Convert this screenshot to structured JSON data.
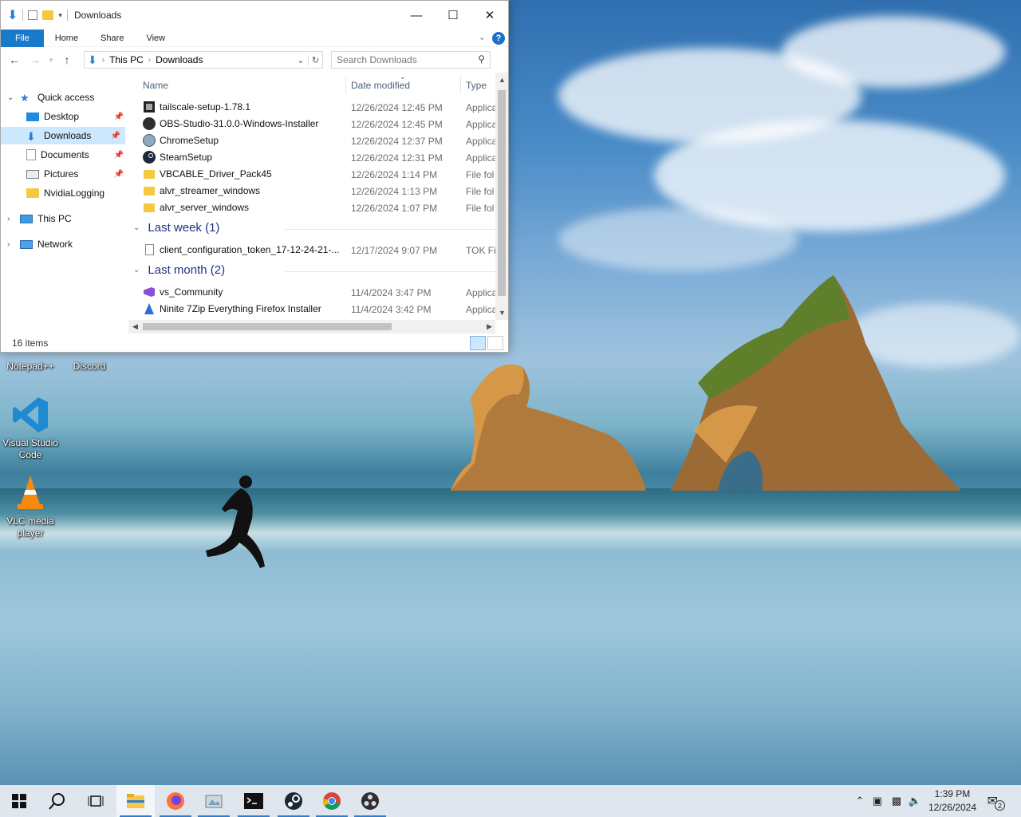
{
  "window": {
    "title": "Downloads",
    "ribbon_tabs": [
      "File",
      "Home",
      "Share",
      "View"
    ],
    "help_label": "?",
    "address": {
      "root": "This PC",
      "current": "Downloads"
    },
    "search_placeholder": "Search Downloads",
    "status_count": "16 items"
  },
  "nav_pane": {
    "quick_access": "Quick access",
    "items": [
      {
        "label": "Desktop",
        "pinned": true
      },
      {
        "label": "Downloads",
        "pinned": true,
        "selected": true
      },
      {
        "label": "Documents",
        "pinned": true
      },
      {
        "label": "Pictures",
        "pinned": true
      },
      {
        "label": "NvidiaLogging",
        "pinned": false
      }
    ],
    "this_pc": "This PC",
    "network": "Network"
  },
  "columns": {
    "name": "Name",
    "date": "Date modified",
    "type": "Type"
  },
  "files_top": [
    {
      "name": "tailscale-setup-1.78.1",
      "date": "12/26/2024 12:45 PM",
      "type": "Applica",
      "icon": "installer-icon"
    },
    {
      "name": "OBS-Studio-31.0.0-Windows-Installer",
      "date": "12/26/2024 12:45 PM",
      "type": "Applica",
      "icon": "obs-icon"
    },
    {
      "name": "ChromeSetup",
      "date": "12/26/2024 12:37 PM",
      "type": "Applica",
      "icon": "chrome-setup-icon"
    },
    {
      "name": "SteamSetup",
      "date": "12/26/2024 12:31 PM",
      "type": "Applica",
      "icon": "steam-icon"
    },
    {
      "name": "VBCABLE_Driver_Pack45",
      "date": "12/26/2024 1:14 PM",
      "type": "File fol",
      "icon": "folder-icon"
    },
    {
      "name": "alvr_streamer_windows",
      "date": "12/26/2024 1:13 PM",
      "type": "File fol",
      "icon": "folder-icon"
    },
    {
      "name": "alvr_server_windows",
      "date": "12/26/2024 1:07 PM",
      "type": "File fol",
      "icon": "folder-icon"
    }
  ],
  "group_last_week": {
    "label": "Last week (1)"
  },
  "files_last_week": [
    {
      "name": "client_configuration_token_17-12-24-21-...",
      "date": "12/17/2024 9:07 PM",
      "type": "TOK Fil",
      "icon": "file-icon"
    }
  ],
  "group_last_month": {
    "label": "Last month (2)"
  },
  "files_last_month": [
    {
      "name": "vs_Community",
      "date": "11/4/2024 3:47 PM",
      "type": "Applica",
      "icon": "visual-studio-icon"
    },
    {
      "name": "Ninite 7Zip Everything Firefox Installer",
      "date": "11/4/2024 3:42 PM",
      "type": "Applica",
      "icon": "ninite-icon"
    }
  ],
  "desktop_icons": [
    {
      "label": "Notepad++"
    },
    {
      "label": "Discord"
    },
    {
      "label": "Visual Studio Code"
    },
    {
      "label": "VLC media player"
    }
  ],
  "taskbar": {
    "time": "1:39 PM",
    "date": "12/26/2024",
    "notification_count": "2"
  }
}
